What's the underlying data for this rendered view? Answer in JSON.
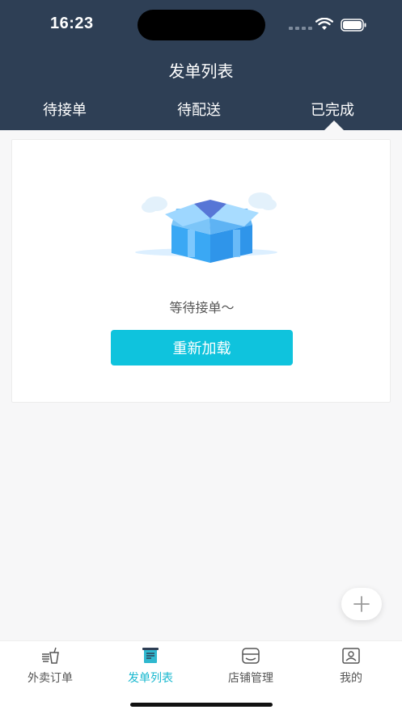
{
  "status_bar": {
    "time": "16:23"
  },
  "header": {
    "title": "发单列表"
  },
  "tabs": [
    {
      "label": "待接单"
    },
    {
      "label": "待配送"
    },
    {
      "label": "已完成"
    }
  ],
  "empty_state": {
    "message": "等待接单～",
    "reload_label": "重新加载"
  },
  "tab_bar": [
    {
      "label": "外卖订单",
      "icon": "takeout-icon"
    },
    {
      "label": "发单列表",
      "icon": "order-list-icon"
    },
    {
      "label": "店铺管理",
      "icon": "store-icon"
    },
    {
      "label": "我的",
      "icon": "profile-card-icon"
    }
  ],
  "colors": {
    "header_bg": "#2e3f55",
    "accent": "#0fc3dd",
    "active_tab": "#18b8cf"
  }
}
